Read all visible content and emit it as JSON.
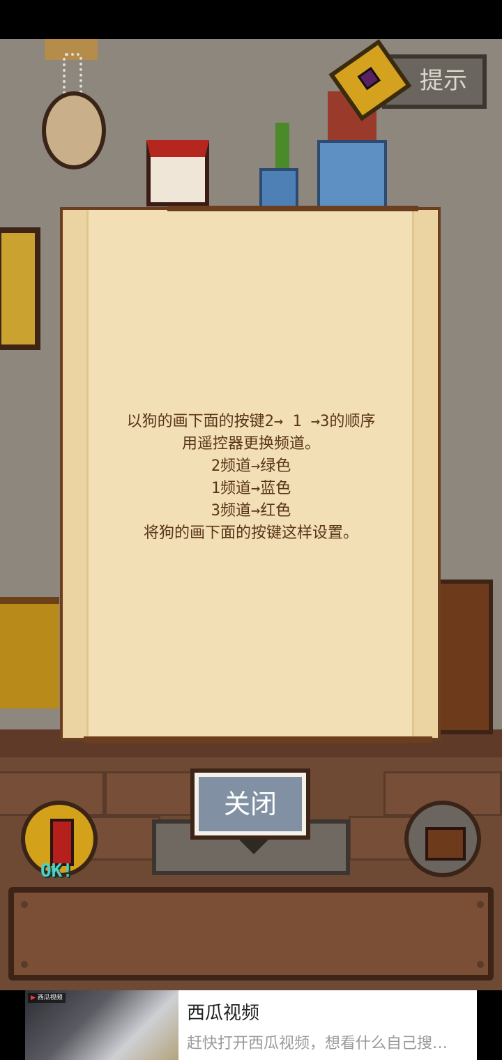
{
  "hint_button": {
    "label": "提示"
  },
  "scroll": {
    "lines": [
      "以狗的画下面的按键2→ 1 →3的顺序",
      "用遥控器更换频道。",
      "2频道→绿色",
      "1频道→蓝色",
      "3频道→红色",
      "将狗的画下面的按键这样设置。"
    ]
  },
  "close_button": {
    "label": "关闭"
  },
  "inventory": {
    "left_item_label": "OK!"
  },
  "ad": {
    "thumb_badge": "西瓜视频",
    "title": "西瓜视频",
    "description": "赶快打开西瓜视频，想看什么自己搜…"
  },
  "colors": {
    "scroll_bg": "#f2dfb6",
    "scroll_text": "#5a3418",
    "close_button_bg": "#8191a3"
  }
}
